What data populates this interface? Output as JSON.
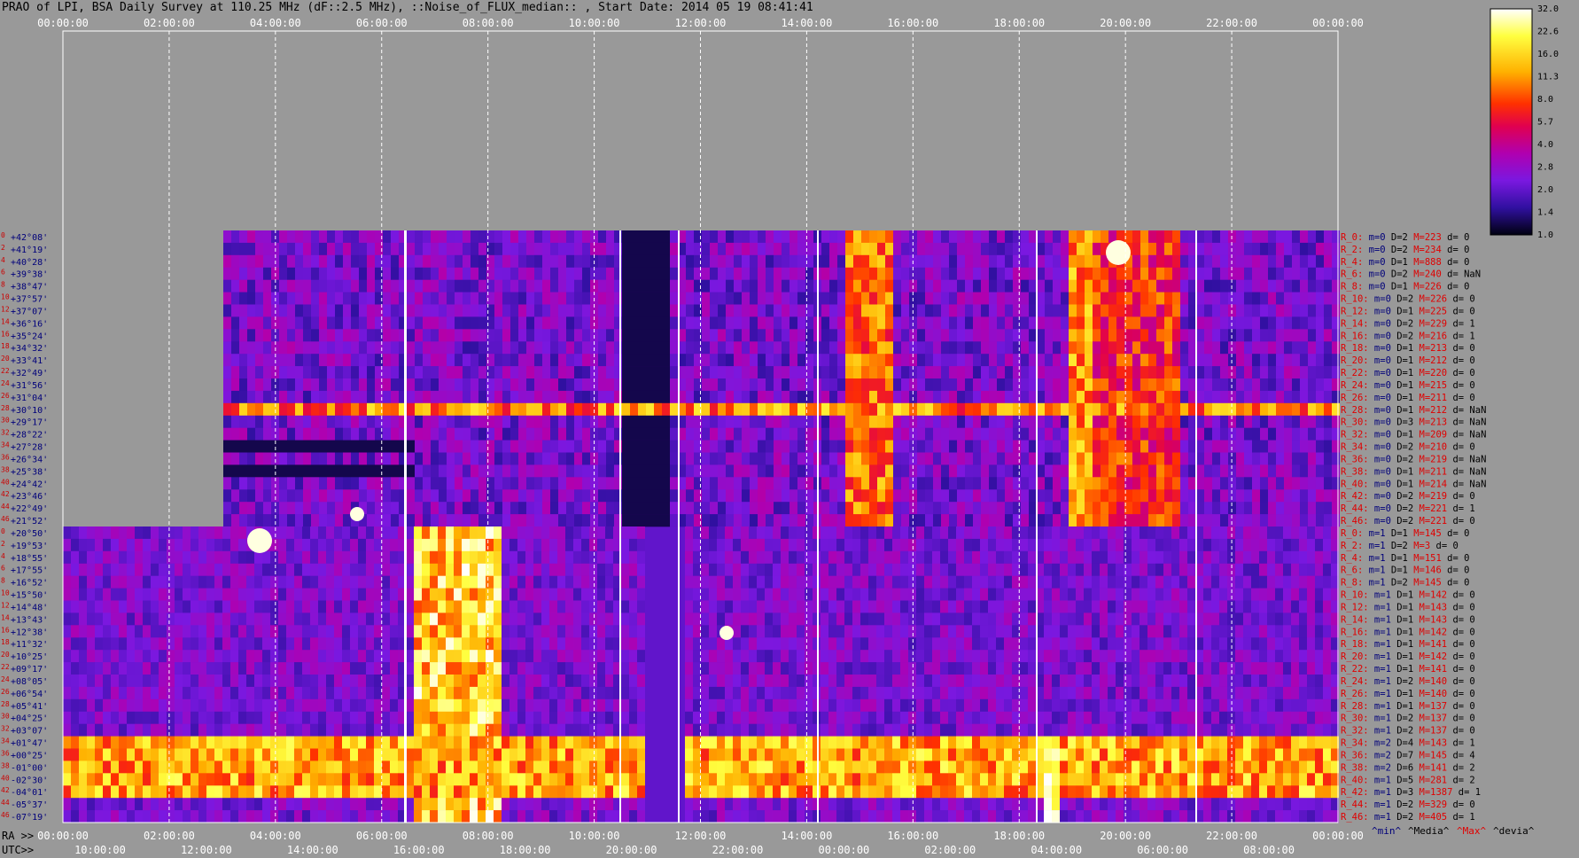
{
  "title": "PRAO of LPI, BSA Daily Survey at 110.25 MHz (dF::2.5 MHz), ::Noise_of_FLUX_median:: , Start Date: 2014 05 19 08:41:41",
  "colors": {
    "background": "#999999",
    "dec_label": "#00007a",
    "row_index": "#cc0000",
    "stat_blue": "#00007a",
    "stat_red": "#e00000",
    "white_marker": "#ffffff"
  },
  "chart_data": {
    "type": "heatmap",
    "title": "PRAO of LPI, BSA Daily Survey at 110.25 MHz (dF::2.5 MHz), ::Noise_of_FLUX_median:: , Start Date: 2014 05 19 08:41:41",
    "x_axis_top_ticks": [
      "00:00:00",
      "02:00:00",
      "04:00:00",
      "06:00:00",
      "08:00:00",
      "10:00:00",
      "12:00:00",
      "14:00:00",
      "16:00:00",
      "18:00:00",
      "20:00:00",
      "22:00:00",
      "00:00:00"
    ],
    "x_axis_bottom_ra_label": "RA >>",
    "x_axis_bottom_ra_ticks": [
      "00:00:00",
      "02:00:00",
      "04:00:00",
      "06:00:00",
      "08:00:00",
      "10:00:00",
      "12:00:00",
      "14:00:00",
      "16:00:00",
      "18:00:00",
      "20:00:00",
      "22:00:00",
      "00:00:00"
    ],
    "x_axis_bottom_utc_label": "UTC>>",
    "x_axis_bottom_utc_ticks": [
      "10:00:00",
      "12:00:00",
      "14:00:00",
      "16:00:00",
      "18:00:00",
      "20:00:00",
      "22:00:00",
      "00:00:00",
      "02:00:00",
      "04:00:00",
      "06:00:00",
      "08:00:00"
    ],
    "colorbar": {
      "labels": [
        "32.0",
        "22.6",
        "16.0",
        "11.3",
        "8.0",
        "5.7",
        "4.0",
        "2.8",
        "2.0",
        "1.4",
        "1.0"
      ],
      "scale": "log",
      "range": [
        1.0,
        32.0
      ]
    },
    "upper_block": {
      "declinations": [
        "+42°08'",
        "+41°19'",
        "+40°28'",
        "+39°38'",
        "+38°47'",
        "+37°57'",
        "+37°07'",
        "+36°16'",
        "+35°24'",
        "+34°32'",
        "+33°41'",
        "+32°49'",
        "+31°56'",
        "+31°04'",
        "+30°10'",
        "+29°17'",
        "+28°22'",
        "+27°28'",
        "+26°34'",
        "+25°38'",
        "+24°42'",
        "+23°46'",
        "+22°49'",
        "+21°52'"
      ],
      "stats": [
        {
          "r": "R_0:",
          "m": "m=0",
          "D": "D=2",
          "M": "M=223",
          "d": "d= 0"
        },
        {
          "r": "R_2:",
          "m": "m=0",
          "D": "D=2",
          "M": "M=234",
          "d": "d= 0"
        },
        {
          "r": "R_4:",
          "m": "m=0",
          "D": "D=1",
          "M": "M=888",
          "d": "d= 0"
        },
        {
          "r": "R_6:",
          "m": "m=0",
          "D": "D=2",
          "M": "M=240",
          "d": "d= NaN"
        },
        {
          "r": "R_8:",
          "m": "m=0",
          "D": "D=1",
          "M": "M=226",
          "d": "d= 0"
        },
        {
          "r": "R_10:",
          "m": "m=0",
          "D": "D=2",
          "M": "M=226",
          "d": "d= 0"
        },
        {
          "r": "R_12:",
          "m": "m=0",
          "D": "D=1",
          "M": "M=225",
          "d": "d= 0"
        },
        {
          "r": "R_14:",
          "m": "m=0",
          "D": "D=2",
          "M": "M=229",
          "d": "d= 1"
        },
        {
          "r": "R_16:",
          "m": "m=0",
          "D": "D=2",
          "M": "M=216",
          "d": "d= 1"
        },
        {
          "r": "R_18:",
          "m": "m=0",
          "D": "D=1",
          "M": "M=213",
          "d": "d= 0"
        },
        {
          "r": "R_20:",
          "m": "m=0",
          "D": "D=1",
          "M": "M=212",
          "d": "d= 0"
        },
        {
          "r": "R_22:",
          "m": "m=0",
          "D": "D=1",
          "M": "M=220",
          "d": "d= 0"
        },
        {
          "r": "R_24:",
          "m": "m=0",
          "D": "D=1",
          "M": "M=215",
          "d": "d= 0"
        },
        {
          "r": "R_26:",
          "m": "m=0",
          "D": "D=1",
          "M": "M=211",
          "d": "d= 0"
        },
        {
          "r": "R_28:",
          "m": "m=0",
          "D": "D=1",
          "M": "M=212",
          "d": "d= NaN"
        },
        {
          "r": "R_30:",
          "m": "m=0",
          "D": "D=3",
          "M": "M=213",
          "d": "d= NaN"
        },
        {
          "r": "R_32:",
          "m": "m=0",
          "D": "D=1",
          "M": "M=209",
          "d": "d= NaN"
        },
        {
          "r": "R_34:",
          "m": "m=0",
          "D": "D=2",
          "M": "M=210",
          "d": "d= 0"
        },
        {
          "r": "R_36:",
          "m": "m=0",
          "D": "D=2",
          "M": "M=219",
          "d": "d= NaN"
        },
        {
          "r": "R_38:",
          "m": "m=0",
          "D": "D=1",
          "M": "M=211",
          "d": "d= NaN"
        },
        {
          "r": "R_40:",
          "m": "m=0",
          "D": "D=1",
          "M": "M=214",
          "d": "d= NaN"
        },
        {
          "r": "R_42:",
          "m": "m=0",
          "D": "D=2",
          "M": "M=219",
          "d": "d= 0"
        },
        {
          "r": "R_44:",
          "m": "m=0",
          "D": "D=2",
          "M": "M=221",
          "d": "d= 1"
        },
        {
          "r": "R_46:",
          "m": "m=0",
          "D": "D=2",
          "M": "M=221",
          "d": "d= 0"
        }
      ]
    },
    "lower_block": {
      "declinations": [
        "+20°50'",
        "+19°53'",
        "+18°55'",
        "+17°55'",
        "+16°52'",
        "+15°50'",
        "+14°48'",
        "+13°43'",
        "+12°38'",
        "+11°32'",
        "+10°25'",
        "+09°17'",
        "+08°05'",
        "+06°54'",
        "+05°41'",
        "+04°25'",
        "+03°07'",
        "+01°47'",
        "+00°25'",
        "-01°00'",
        "-02°30'",
        "-04°01'",
        "-05°37'",
        "-07°19'"
      ],
      "stats": [
        {
          "r": "R_0:",
          "m": "m=1",
          "D": "D=1",
          "M": "M=145",
          "d": "d= 0"
        },
        {
          "r": "R_2:",
          "m": "m=1",
          "D": "D=2",
          "M": "M=3",
          "d": "d= 0"
        },
        {
          "r": "R_4:",
          "m": "m=1",
          "D": "D=1",
          "M": "M=151",
          "d": "d= 0"
        },
        {
          "r": "R_6:",
          "m": "m=1",
          "D": "D=1",
          "M": "M=146",
          "d": "d= 0"
        },
        {
          "r": "R_8:",
          "m": "m=1",
          "D": "D=2",
          "M": "M=145",
          "d": "d= 0"
        },
        {
          "r": "R_10:",
          "m": "m=1",
          "D": "D=1",
          "M": "M=142",
          "d": "d= 0"
        },
        {
          "r": "R_12:",
          "m": "m=1",
          "D": "D=1",
          "M": "M=143",
          "d": "d= 0"
        },
        {
          "r": "R_14:",
          "m": "m=1",
          "D": "D=1",
          "M": "M=143",
          "d": "d= 0"
        },
        {
          "r": "R_16:",
          "m": "m=1",
          "D": "D=1",
          "M": "M=142",
          "d": "d= 0"
        },
        {
          "r": "R_18:",
          "m": "m=1",
          "D": "D=1",
          "M": "M=141",
          "d": "d= 0"
        },
        {
          "r": "R_20:",
          "m": "m=1",
          "D": "D=1",
          "M": "M=142",
          "d": "d= 0"
        },
        {
          "r": "R_22:",
          "m": "m=1",
          "D": "D=1",
          "M": "M=141",
          "d": "d= 0"
        },
        {
          "r": "R_24:",
          "m": "m=1",
          "D": "D=2",
          "M": "M=140",
          "d": "d= 0"
        },
        {
          "r": "R_26:",
          "m": "m=1",
          "D": "D=1",
          "M": "M=140",
          "d": "d= 0"
        },
        {
          "r": "R_28:",
          "m": "m=1",
          "D": "D=1",
          "M": "M=137",
          "d": "d= 0"
        },
        {
          "r": "R_30:",
          "m": "m=1",
          "D": "D=2",
          "M": "M=137",
          "d": "d= 0"
        },
        {
          "r": "R_32:",
          "m": "m=1",
          "D": "D=2",
          "M": "M=137",
          "d": "d= 0"
        },
        {
          "r": "R_34:",
          "m": "m=2",
          "D": "D=4",
          "M": "M=143",
          "d": "d= 1"
        },
        {
          "r": "R_36:",
          "m": "m=2",
          "D": "D=7",
          "M": "M=145",
          "d": "d= 4"
        },
        {
          "r": "R_38:",
          "m": "m=2",
          "D": "D=6",
          "M": "M=141",
          "d": "d= 2"
        },
        {
          "r": "R_40:",
          "m": "m=1",
          "D": "D=5",
          "M": "M=281",
          "d": "d= 2"
        },
        {
          "r": "R_42:",
          "m": "m=1",
          "D": "D=3",
          "M": "M=1387",
          "d": "d= 1"
        },
        {
          "r": "R_44:",
          "m": "m=1",
          "D": "D=2",
          "M": "M=329",
          "d": "d= 0"
        },
        {
          "r": "R_46:",
          "m": "m=1",
          "D": "D=2",
          "M": "M=405",
          "d": "d= 1"
        }
      ]
    },
    "legend": [
      "^min^",
      "^Media^",
      "^Max^",
      "^devia^"
    ]
  }
}
